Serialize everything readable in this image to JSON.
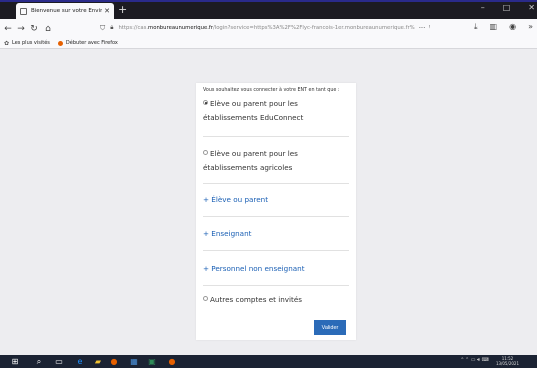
{
  "browser": {
    "tab_title": "Bienvenue sur votre Environne",
    "url_prefix": "https://cas.",
    "url_host": "monbureaunumerique.fr",
    "url_rest": "/login?service=https%3A%2F%2Flyc-francois-1er.monbureaunumerique.fr%",
    "bookmarks": [
      {
        "label": "Les plus visités",
        "icon": "gear-icon",
        "color": "#555555"
      },
      {
        "label": "Débuter avec Firefox",
        "icon": "firefox-icon",
        "color": "#e66000"
      }
    ]
  },
  "login": {
    "intro": "Vous souhaitez vous connecter à votre ENT en tant que :",
    "options": [
      {
        "label": "Elève ou parent pour les établissements EduConnect",
        "selected": true
      },
      {
        "label": "Elève ou parent pour les établissements agricoles",
        "selected": false
      }
    ],
    "links": [
      "+ Élève ou parent",
      "+ Enseignant",
      "+ Personnel non enseignant"
    ],
    "other": {
      "label": "Autres comptes et invités",
      "selected": false
    },
    "submit_label": "Valider"
  },
  "taskbar": {
    "time": "11:52",
    "date": "13/05/2021"
  },
  "colors": {
    "accent": "#2b6bb8",
    "link": "#1a5fb4",
    "taskbar": "#1b2333"
  }
}
